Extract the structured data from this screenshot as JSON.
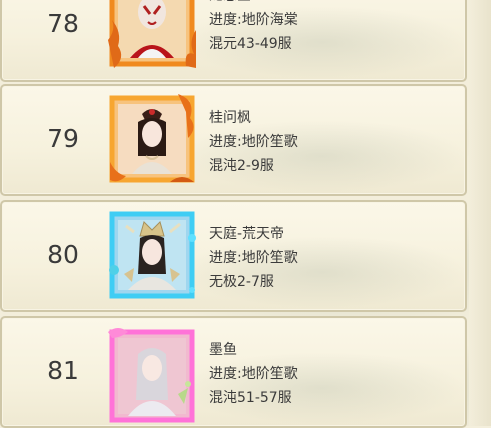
{
  "players": [
    {
      "rank": "78",
      "name": "龙忘丞",
      "progress": "进度:地阶海棠",
      "server": "混元43-49服",
      "frame_color": "#e8822a",
      "frame": "flame-frame"
    },
    {
      "rank": "79",
      "name": "桂问枫",
      "progress": "进度:地阶笙歌",
      "server": "混沌2-9服",
      "frame_color": "#f08a1f",
      "frame": "flame-frame"
    },
    {
      "rank": "80",
      "name": "天庭-荒天帝",
      "progress": "进度:地阶笙歌",
      "server": "无极2-7服",
      "frame_color": "#35c8f0",
      "frame": "ice-frame"
    },
    {
      "rank": "81",
      "name": "墨鱼",
      "progress": "进度:地阶笙歌",
      "server": "混沌51-57服",
      "frame_color": "#ff6ad5",
      "frame": "pink-frame"
    }
  ]
}
